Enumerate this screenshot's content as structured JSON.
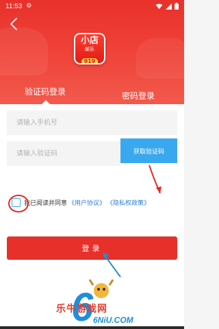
{
  "status_bar": {
    "time": "11:53",
    "icons": [
      "settings-icon",
      "wifi-icon",
      "signal-icon",
      "battery-icon"
    ]
  },
  "app": {
    "logo_line1": "小店",
    "logo_line2": "邮乐",
    "logo_number": "919"
  },
  "tabs": [
    {
      "label": "验证码登录",
      "active": true
    },
    {
      "label": "密码登录",
      "active": false
    }
  ],
  "form": {
    "phone_placeholder": "请输入手机号",
    "phone_value": "",
    "code_placeholder": "请输入验证码",
    "code_value": "",
    "get_code_label": "获取验证码"
  },
  "agreement": {
    "checked": false,
    "text": "我已阅读并同意",
    "user_agreement": "《用户协议》",
    "privacy_policy": "《隐私权政策》"
  },
  "login_button": {
    "label": "登录"
  },
  "watermark": {
    "brand": "乐牛游戏网",
    "domain": "6NiU.COM"
  },
  "colors": {
    "brand_red": "#e8302a",
    "accent_blue": "#3aa8ee",
    "link_blue": "#2b7fd6"
  }
}
